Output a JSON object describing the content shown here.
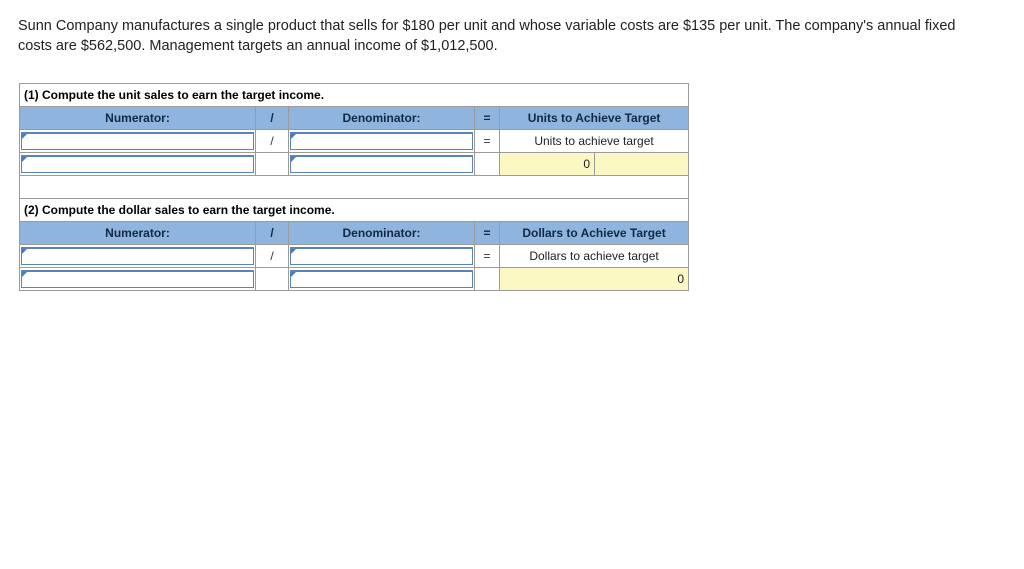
{
  "problem": {
    "text": "Sunn Company manufactures a single product that sells for $180 per unit and whose variable costs are $135 per unit. The company's annual fixed costs are $562,500. Management targets an annual income of $1,012,500.",
    "selling_price_per_unit": "$180",
    "variable_cost_per_unit": "$135",
    "annual_fixed_costs": "$562,500",
    "target_annual_income": "$1,012,500"
  },
  "worksheet": {
    "sections": [
      {
        "caption": "(1) Compute the unit sales to earn the target income.",
        "headers": {
          "numerator": "Numerator:",
          "slash": "/",
          "denominator": "Denominator:",
          "equals": "=",
          "result": "Units to Achieve Target"
        },
        "row_formula": {
          "numerator_value": "",
          "slash": "/",
          "denominator_value": "",
          "equals": "=",
          "result_label": "Units to achieve target"
        },
        "row_answer": {
          "numerator_value": "",
          "slash": "",
          "denominator_value": "",
          "equals": "",
          "answer": "0",
          "answer_extra": ""
        }
      },
      {
        "caption": "(2) Compute the dollar sales to earn the target income.",
        "headers": {
          "numerator": "Numerator:",
          "slash": "/",
          "denominator": "Denominator:",
          "equals": "=",
          "result": "Dollars to Achieve Target"
        },
        "row_formula": {
          "numerator_value": "",
          "slash": "/",
          "denominator_value": "",
          "equals": "=",
          "result_label": "Dollars to achieve target"
        },
        "row_answer": {
          "numerator_value": "",
          "slash": "",
          "denominator_value": "",
          "equals": "",
          "answer": "0"
        }
      }
    ]
  },
  "colors": {
    "header_blue": "#8FB4DE",
    "answer_yellow": "#FBF8C4",
    "entry_border_blue": "#5A83B8",
    "grid_line": "#9b9b9b",
    "page_background": "#ffffff"
  }
}
